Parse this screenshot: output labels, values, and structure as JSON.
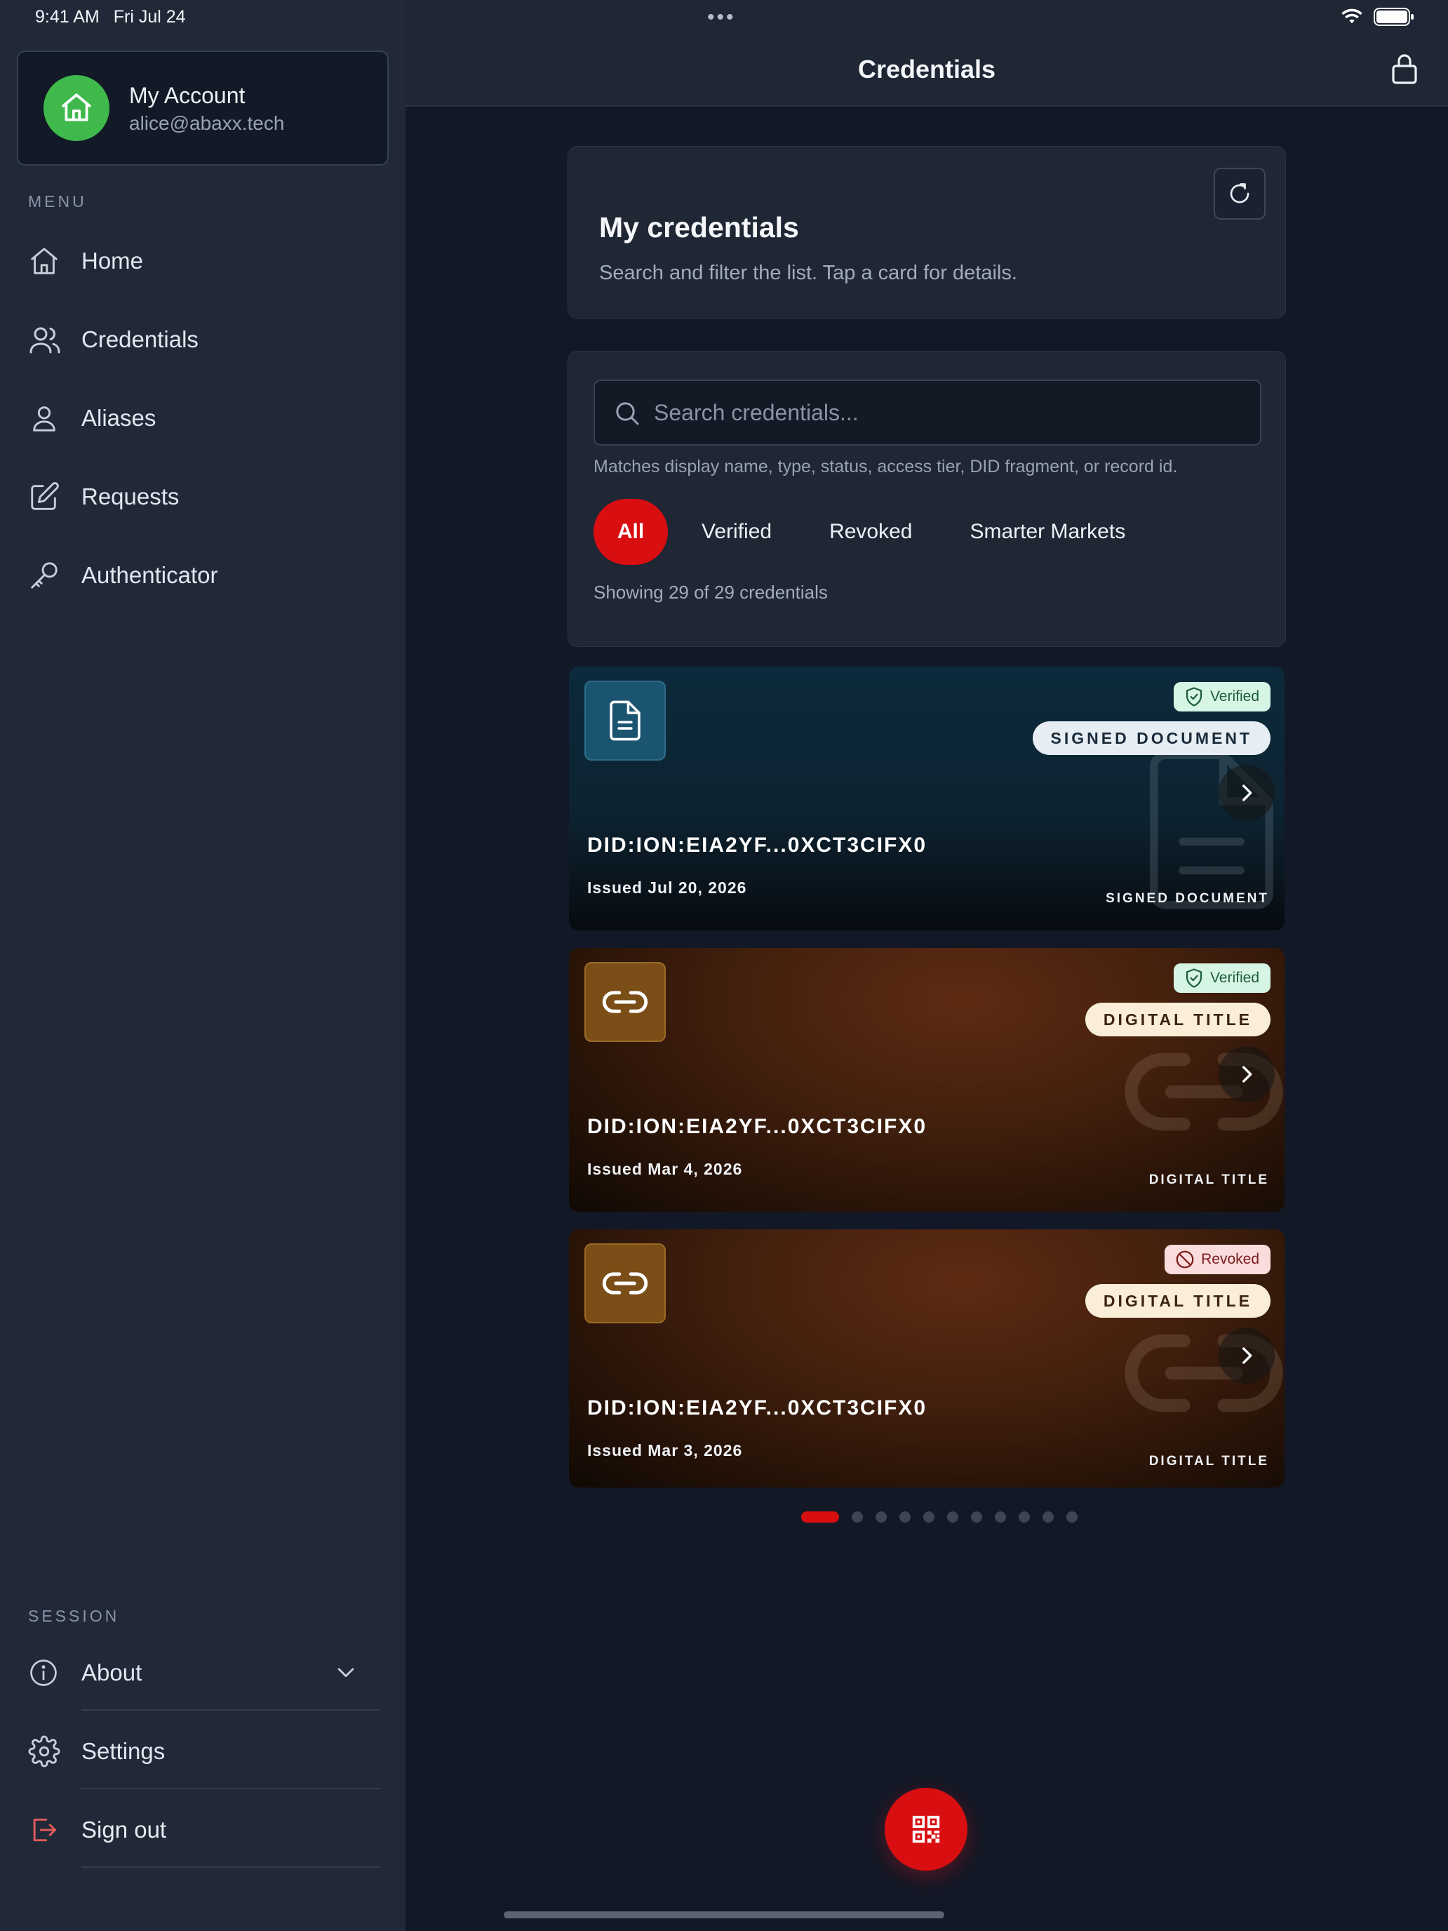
{
  "status_bar": {
    "time": "9:41 AM",
    "date": "Fri Jul 24"
  },
  "account": {
    "name": "My Account",
    "email": "alice@abaxx.tech"
  },
  "sidebar": {
    "menu_label": "MENU",
    "items": [
      {
        "label": "Home",
        "icon": "home-icon"
      },
      {
        "label": "Credentials",
        "icon": "users-icon"
      },
      {
        "label": "Aliases",
        "icon": "user-icon"
      },
      {
        "label": "Requests",
        "icon": "edit-icon"
      },
      {
        "label": "Authenticator",
        "icon": "key-icon"
      }
    ],
    "session_label": "SESSION",
    "session_items": [
      {
        "label": "About",
        "icon": "info-icon"
      },
      {
        "label": "Settings",
        "icon": "gear-icon"
      },
      {
        "label": "Sign out",
        "icon": "logout-icon"
      }
    ]
  },
  "topbar": {
    "title": "Credentials",
    "dots": "•••"
  },
  "header": {
    "title": "My credentials",
    "subtitle": "Search and filter the list. Tap a card for details."
  },
  "search": {
    "placeholder": "Search credentials...",
    "value": "",
    "hint": "Matches display name, type, status, access tier, DID fragment, or record id."
  },
  "filters": {
    "chips": [
      "All",
      "Verified",
      "Revoked",
      "Smarter Markets"
    ],
    "active": "All"
  },
  "showing_text": "Showing 29 of 29 credentials",
  "credentials": [
    {
      "status": "Verified",
      "type": "SIGNED DOCUMENT",
      "did": "DID:ION:EIA2YF...0XCT3CIFX0",
      "issued": "Issued Jul 20, 2026",
      "footer": "SIGNED DOCUMENT"
    },
    {
      "status": "Verified",
      "type": "DIGITAL TITLE",
      "did": "DID:ION:EIA2YF...0XCT3CIFX0",
      "issued": "Issued Mar 4, 2026",
      "footer": "DIGITAL TITLE"
    },
    {
      "status": "Revoked",
      "type": "DIGITAL TITLE",
      "did": "DID:ION:EIA2YF...0XCT3CIFX0",
      "issued": "Issued Mar 3, 2026",
      "footer": "DIGITAL TITLE"
    }
  ],
  "pager": {
    "pages": 11,
    "current": 1
  },
  "colors": {
    "accent": "#d90e11",
    "avatar": "#3fb94c",
    "sidebar_bg": "#212938",
    "main_bg": "#121826",
    "signout": "#e05a5a"
  }
}
